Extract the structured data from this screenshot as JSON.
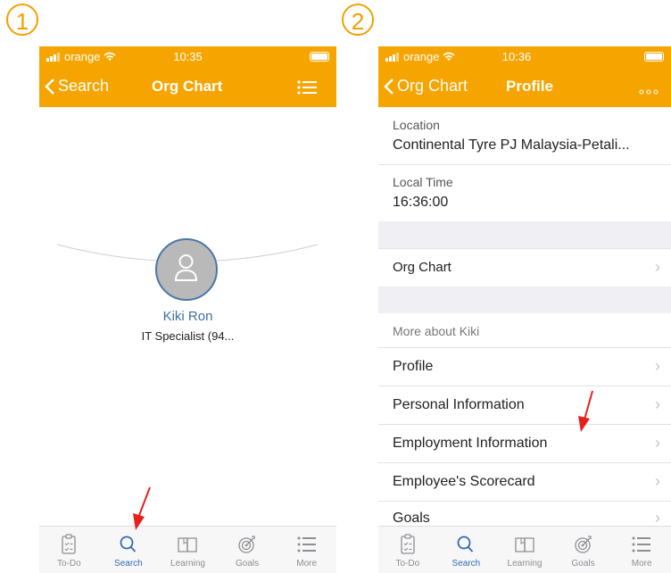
{
  "steps": [
    "1",
    "2"
  ],
  "phone1": {
    "carrier": "orange",
    "time": "10:35",
    "back_label": "Search",
    "title": "Org Chart",
    "person_name": "Kiki Ron",
    "person_title": "IT Specialist (94..."
  },
  "phone2": {
    "carrier": "orange",
    "time": "10:36",
    "back_label": "Org Chart",
    "title": "Profile",
    "location_label": "Location",
    "location_value": "Continental Tyre PJ Malaysia-Petali...",
    "localtime_label": "Local Time",
    "localtime_value": "16:36:00",
    "org_chart": "Org Chart",
    "section_header": "More about Kiki",
    "items": [
      "Profile",
      "Personal Information",
      "Employment Information",
      "Employee's Scorecard",
      "Goals"
    ]
  },
  "tabs": [
    "To-Do",
    "Search",
    "Learning",
    "Goals",
    "More"
  ],
  "colors": {
    "accent": "#f6a500",
    "active_tab": "#2f6bb3",
    "arrow": "#e8201c"
  }
}
